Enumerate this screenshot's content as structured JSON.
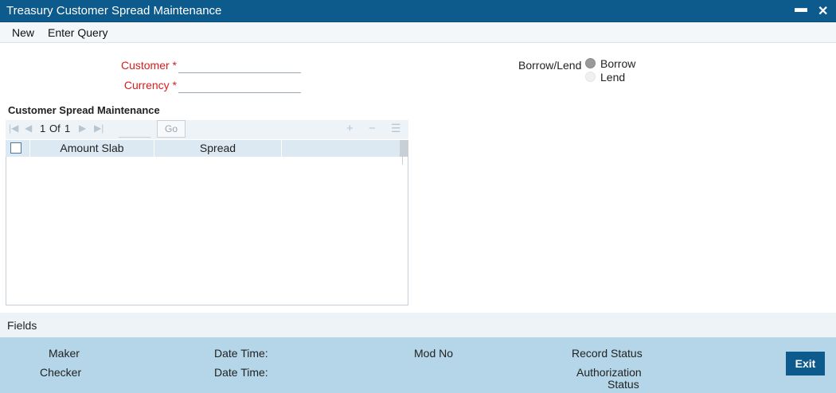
{
  "window": {
    "title": "Treasury Customer Spread Maintenance",
    "minimize_glyph": "▬",
    "close_glyph": "✕"
  },
  "menu": {
    "new": "New",
    "enter_query": "Enter Query"
  },
  "form": {
    "customer_label": "Customer *",
    "customer_value": "",
    "currency_label": "Currency *",
    "currency_value": "",
    "borrow_lend_label": "Borrow/Lend",
    "options": [
      {
        "label": "Borrow",
        "selected": true
      },
      {
        "label": "Lend",
        "selected": false
      }
    ]
  },
  "grid": {
    "title": "Customer Spread Maintenance",
    "pager": {
      "current": "1",
      "of": "Of",
      "total": "1",
      "go": "Go",
      "page_input": ""
    },
    "icons": [
      "first-page-icon",
      "prev-page-icon",
      "next-page-icon",
      "last-page-icon",
      "add-row-icon",
      "delete-row-icon",
      "single-view-icon"
    ],
    "columns": [
      "Amount Slab",
      "Spread"
    ],
    "rows": []
  },
  "fields": {
    "label": "Fields"
  },
  "footer": {
    "maker": "Maker",
    "checker": "Checker",
    "date_time_1": "Date Time:",
    "date_time_2": "Date Time:",
    "mod_no": "Mod No",
    "record_status": "Record Status",
    "auth_status_1": "Authorization",
    "auth_status_2": "Status",
    "exit": "Exit"
  },
  "colors": {
    "title_bg": "#0d5a8c",
    "required": "#d91d1d",
    "footer_bg": "#b5d6e8",
    "grid_head": "#dde9f2"
  }
}
